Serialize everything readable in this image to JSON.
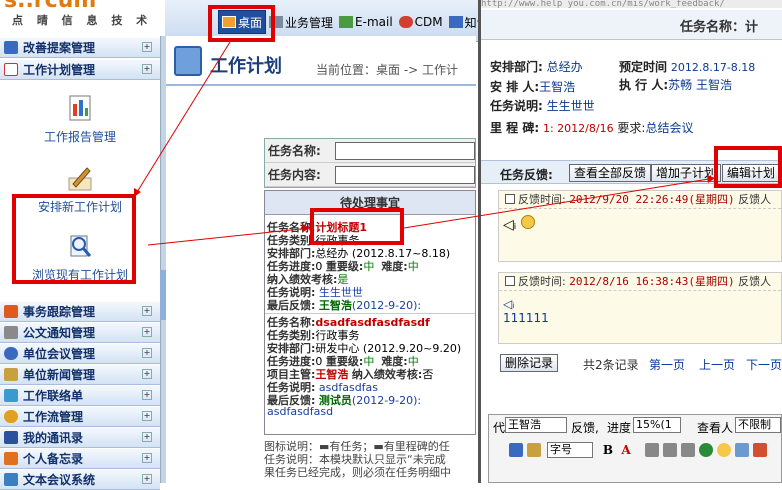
{
  "header": {
    "logo_brand": "s..rcum",
    "logo_sub": "点 晴 信 息 技 术",
    "nav": [
      {
        "label": "桌面",
        "icon": "desktop-icon",
        "active": true
      },
      {
        "label": "业务管理",
        "icon": "business-icon"
      },
      {
        "label": "E-mail",
        "icon": "email-icon"
      },
      {
        "label": "CDM",
        "icon": "cdm-icon"
      },
      {
        "label": "知识",
        "icon": "knowledge-icon"
      }
    ]
  },
  "sidebar": {
    "sections_top": [
      {
        "label": "改善提案管理",
        "icon": "proposal-icon"
      },
      {
        "label": "工作计划管理",
        "icon": "calendar-icon"
      }
    ],
    "tools": [
      {
        "label": "工作报告管理",
        "icon": "report-icon"
      },
      {
        "label": "安排新工作计划",
        "icon": "pen-icon"
      },
      {
        "label": "浏览现有工作计划",
        "icon": "browse-icon"
      }
    ],
    "sections_bottom": [
      {
        "label": "事务跟踪管理",
        "icon": "track-icon"
      },
      {
        "label": "公文通知管理",
        "icon": "notice-icon"
      },
      {
        "label": "单位会议管理",
        "icon": "meeting-icon"
      },
      {
        "label": "单位新闻管理",
        "icon": "news-icon"
      },
      {
        "label": "工作联络单",
        "icon": "contact-icon"
      },
      {
        "label": "工作流管理",
        "icon": "workflow-icon"
      },
      {
        "label": "我的通讯录",
        "icon": "addressbook-icon"
      },
      {
        "label": "个人备忘录",
        "icon": "memo-icon"
      },
      {
        "label": "文本会议系统",
        "icon": "textmeeting-icon"
      }
    ]
  },
  "main": {
    "title": "工作计划",
    "breadcrumb": "当前位置：桌面 -> 工作计",
    "form": {
      "name_label": "任务名称:",
      "content_label": "任务内容:"
    },
    "pending_header": "待处理事宜",
    "task1": {
      "name_label": "任务名称:",
      "name": "计划标题1",
      "type_label": "任务类别:",
      "type": "行政事务",
      "dept_label": "安排部门:",
      "dept": "总经办 (2012.8.17~8.18)",
      "progress_label": "任务进度:",
      "progress": "0",
      "importance_label": "重要级:",
      "importance": "中",
      "difficulty_label": "难度:",
      "difficulty": "中",
      "perf_label": "纳入绩效考核:",
      "perf": "是",
      "desc_label": "任务说明:",
      "desc": "生生世世",
      "last_label": "最后反馈:",
      "last_user": "王智浩",
      "last_date": "(2012-9-20):"
    },
    "task2": {
      "name_label": "任务名称:",
      "name": "dsadfasdfasdfasdf",
      "type_label": "任务类别:",
      "type": "行政事务",
      "dept_label": "安排部门:",
      "dept": "研发中心 (2012.9.20~9.20)",
      "progress_label": "任务进度:",
      "progress": "0",
      "importance_label": "重要级:",
      "importance": "中",
      "difficulty_label": "难度:",
      "difficulty": "中",
      "owner_label": "项目主管:",
      "owner": "王智浩",
      "perf_label": "纳入绩效考核:",
      "perf": "否",
      "desc_label": "任务说明:",
      "desc": "asdfasdfas",
      "last_label": "最后反馈:",
      "last_user": "测试员",
      "last_date": "(2012-9-20):",
      "last_text": "asdfasdfasd"
    },
    "legend_line1": "图标说明：▬有任务；▬有里程碑的任",
    "legend_line2": "任务说明：本模块默认只显示“未完成",
    "legend_line3": "果任务已经完成，则必须在任务明细中"
  },
  "popup": {
    "url": "http://www.help you.com.cn/mis/work_feedback/",
    "title": "任务名称：计",
    "dept_label": "安排部门:",
    "dept": "总经办",
    "schedule_label": "预定时间",
    "schedule": "2012.8.17-8.18",
    "planner_label": "安 排 人:",
    "planner": "王智浩",
    "executor_label": "执 行 人:",
    "executor": "苏畅  王智浩",
    "desc_label": "任务说明:",
    "desc": "生生世世",
    "milestone_label": "里 程 碑:",
    "milestone": "1: 2012/8/16",
    "require_label": "要求:",
    "require": "总结会议",
    "feedback_label": "任务反馈:",
    "buttons": {
      "view_all": "查看全部反馈",
      "add_sub": "增加子计划",
      "edit": "编辑计划"
    },
    "feedbacks": [
      {
        "label": "反馈时间:",
        "time": "2012/9/20 22:26:49(星期四)",
        "suffix": "反馈人",
        "content": ""
      },
      {
        "label": "反馈时间:",
        "time": "2012/8/16 16:38:43(星期四)",
        "suffix": "反馈人",
        "content": "111111"
      }
    ],
    "pager": {
      "delete": "删除记录",
      "count": "共2条记录",
      "first": "第一页",
      "prev": "上一页",
      "next": "下一页"
    },
    "editor": {
      "prefix": "代",
      "person": "王智浩",
      "feedback": "反馈,",
      "progress_label": "进度",
      "progress": "15%(1",
      "viewer_label": "查看人",
      "viewer": "不限制",
      "font": "字号"
    }
  }
}
